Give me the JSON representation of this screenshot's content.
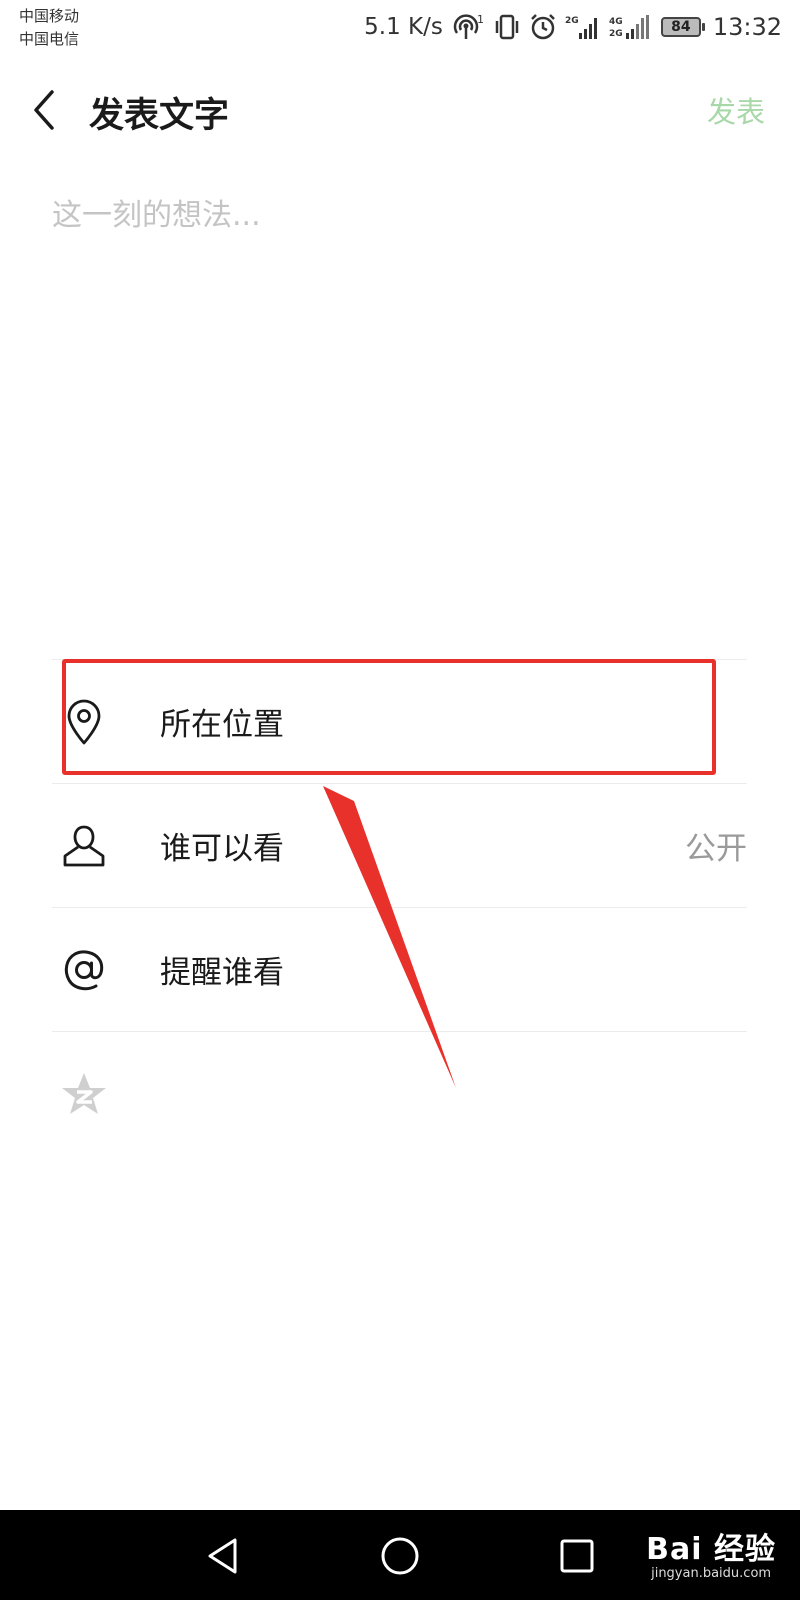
{
  "status_bar": {
    "carrier_1": "中国移动",
    "carrier_2": "中国电信",
    "network_speed": "5.1 K/s",
    "hotspot_badge": "1",
    "signal_1_label": "2G",
    "signal_2_label_top": "4G",
    "signal_2_label_bottom": "2G",
    "battery_level": "84",
    "time": "13:32",
    "icons": [
      "hotspot-icon",
      "vibrate-icon",
      "alarm-icon",
      "signal-icon",
      "signal-icon"
    ]
  },
  "header": {
    "back_icon": "chevron-left-icon",
    "title": "发表文字",
    "publish_label": "发表"
  },
  "editor": {
    "placeholder": "这一刻的想法..."
  },
  "options": {
    "location": {
      "icon": "location-pin-icon",
      "label": "所在位置"
    },
    "visibility": {
      "icon": "person-icon",
      "label": "谁可以看",
      "value": "公开"
    },
    "mention": {
      "icon": "at-icon",
      "label": "提醒谁看"
    },
    "qzone": {
      "icon": "qzone-star-icon"
    }
  },
  "nav_bar": {
    "icons": [
      "back-triangle-icon",
      "home-circle-icon",
      "recents-square-icon"
    ]
  },
  "watermark": {
    "logo_text": "Bai 经验",
    "url": "jingyan.baidu.com"
  },
  "colors": {
    "publish_disabled": "#a8d8a8",
    "annotation_red": "#e8312b",
    "placeholder": "#c4c4c4",
    "secondary_text": "#9a9a9a"
  }
}
